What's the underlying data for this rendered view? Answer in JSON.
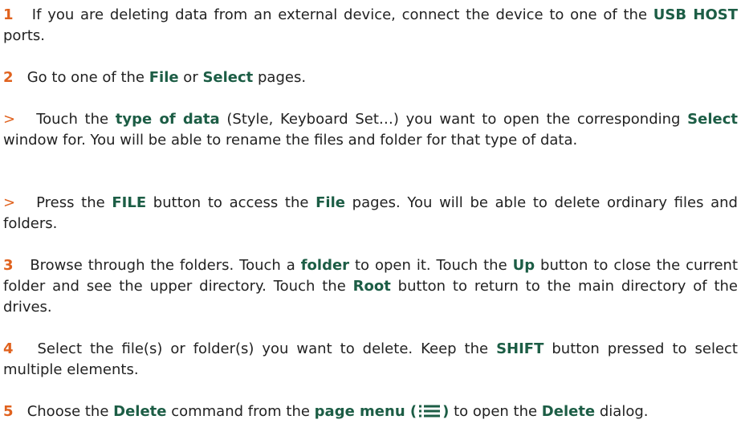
{
  "steps": [
    {
      "marker": "1",
      "parts": [
        {
          "t": "If you are deleting data from an external device, connect the device to one of the "
        },
        {
          "t": "USB HOST",
          "hl": true
        },
        {
          "t": " ports."
        }
      ]
    },
    {
      "marker": "2",
      "parts": [
        {
          "t": "Go to one of the "
        },
        {
          "t": "File",
          "hl": true
        },
        {
          "t": " or "
        },
        {
          "t": "Select",
          "hl": true
        },
        {
          "t": " pages."
        }
      ]
    },
    {
      "marker": ">",
      "parts": [
        {
          "t": "Touch the "
        },
        {
          "t": "type of data",
          "hl": true
        },
        {
          "t": " (Style, Keyboard Set…) you want to open the corresponding "
        },
        {
          "t": "Select",
          "hl": true
        },
        {
          "t": " window for. You will be able to rename the files and folder for that type of data."
        }
      ]
    },
    {
      "marker": ">",
      "parts": [
        {
          "t": "Press the "
        },
        {
          "t": "FILE",
          "hl": true
        },
        {
          "t": " button to access the "
        },
        {
          "t": "File",
          "hl": true
        },
        {
          "t": " pages. You will be able to delete ordinary files and folders."
        }
      ]
    },
    {
      "marker": "3",
      "parts": [
        {
          "t": "Browse through the folders. Touch a "
        },
        {
          "t": "folder",
          "hl": true
        },
        {
          "t": " to open it. Touch the "
        },
        {
          "t": "Up",
          "hl": true
        },
        {
          "t": " button to close the current folder and see the upper directory. Touch the "
        },
        {
          "t": "Root",
          "hl": true
        },
        {
          "t": " button to return to the main directory of the drives."
        }
      ]
    },
    {
      "marker": "4",
      "parts": [
        {
          "t": "Select the file(s) or folder(s) you want to delete. Keep the "
        },
        {
          "t": "SHIFT",
          "hl": true
        },
        {
          "t": " button pressed to select multiple elements."
        }
      ]
    },
    {
      "marker": "5",
      "parts": [
        {
          "t": "Choose the "
        },
        {
          "t": "Delete",
          "hl": true
        },
        {
          "t": " command from the "
        },
        {
          "t": "page menu (",
          "hl": true
        },
        {
          "icon": "page-menu-icon"
        },
        {
          "t": ")",
          "hl": true
        },
        {
          "t": " to open the "
        },
        {
          "t": "Delete",
          "hl": true
        },
        {
          "t": " dialog."
        }
      ]
    }
  ],
  "colors": {
    "marker": "#e0621e",
    "highlight": "#1c5d45",
    "text": "#222222"
  }
}
